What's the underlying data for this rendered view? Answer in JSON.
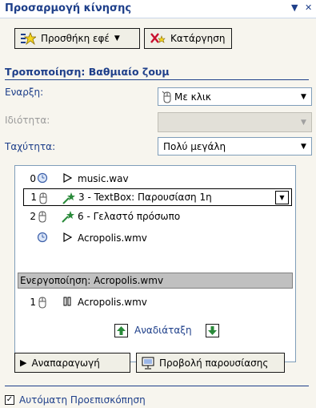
{
  "pane": {
    "title": "Προσαρμογή κίνησης",
    "dropdown_icon": "chevron-down-icon",
    "close_icon": "close-icon"
  },
  "toolbar": {
    "add_effect_label": "Προσθήκη εφέ",
    "remove_label": "Κατάργηση"
  },
  "modify": {
    "heading": "Τροποποίηση: Βαθμιαίο ζουμ",
    "start_label": "Εναρξη:",
    "start_value": "Με κλικ",
    "property_label": "Ιδιότητα:",
    "property_value": "",
    "speed_label": "Ταχύτητα:",
    "speed_value": "Πολύ μεγάλη"
  },
  "animation_list": {
    "items": [
      {
        "num": "0",
        "trigger": "clock",
        "effect": "play",
        "text": "music.wav"
      },
      {
        "num": "1",
        "trigger": "mouse",
        "effect": "star",
        "text": "3 - TextBox: Παρουσίαση 1η"
      },
      {
        "num": "2",
        "trigger": "mouse",
        "effect": "star",
        "text": "6 - Γελαστό πρόσωπο"
      },
      {
        "num": "",
        "trigger": "clock",
        "effect": "play",
        "text": "Acropolis.wmv"
      }
    ],
    "trigger_header": "Ενεργοποίηση: Acropolis.wmv",
    "trigger_items": [
      {
        "num": "1",
        "trigger": "mouse",
        "effect": "pause",
        "text": "Acropolis.wmv"
      }
    ]
  },
  "reorder": {
    "label": "Αναδιάταξη"
  },
  "play_label": "Αναπαραγωγή",
  "slideshow_label": "Προβολή παρουσίασης",
  "autopreview_label": "Αυτόματη Προεπισκόπηση",
  "colors": {
    "accent": "#1e3f8a",
    "header_gray": "#c0c0c0",
    "pane_bg": "#f7f5ee"
  }
}
